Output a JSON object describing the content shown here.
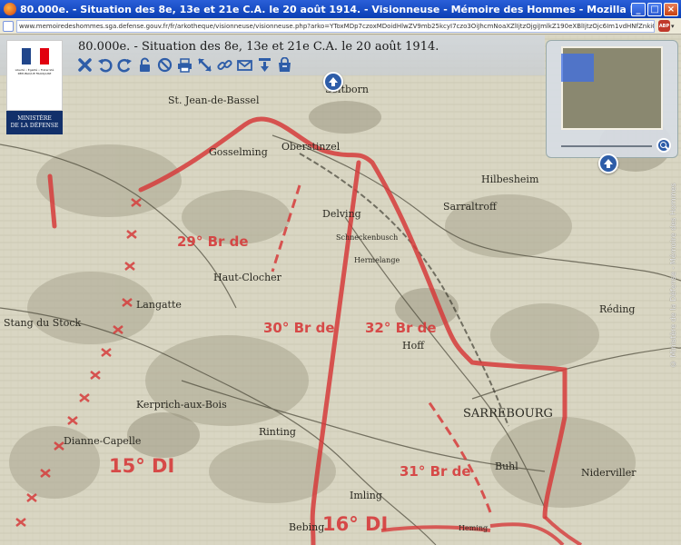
{
  "window": {
    "title": "80.000e. - Situation des 8e, 13e et 21e C.A. le 20 août 1914. - Visionneuse - Mémoire des Hommes - Mozilla Firefox",
    "min_label": "_",
    "max_label": "□",
    "close_label": "×"
  },
  "address": {
    "url": "www.memoiredeshommes.sga.defense.gouv.fr/fr/arkotheque/visionneuse/visionneuse.php?arko=YToxMDp7czoxMDoidHlwZV9mb25kcyI7czo3OiJhcmNoaXZlIjtzOjgiJmlkZ190eXBlIjtzOjc6Im1vdHNfZnkiO3M6NDoicmVmMCI7czoyOiI1NiI7czo0OiJyZWYxIjtpOjE7fQ==",
    "adblock_label": "ABP",
    "adblock_arrow": "▾"
  },
  "viewer": {
    "doc_title": "80.000e. - Situation des 8e, 13e et 21e C.A. le 20 août 1914.",
    "logo_motto": "Liberté • Égalité • Fraternité\nRÉPUBLIQUE FRANÇAISE",
    "ministry": "MINISTÈRE\nDE LA DÉFENSE",
    "copyright": "© Ministère de la Défense - Mémoire des Hommes",
    "tools": [
      "close-view",
      "rotate-left",
      "rotate-right",
      "lock",
      "no-entry",
      "print",
      "fit-screen",
      "link",
      "email",
      "download",
      "cart"
    ]
  },
  "map": {
    "place_labels": [
      "St. Jean-de-Bassel",
      "Oberstinzel",
      "Gosselming",
      "Hilbesheim",
      "Sarraltroff",
      "Delving",
      "Schneckenbusch",
      "Hermelange",
      "Haut-Clocher",
      "Langatte",
      "Hoff",
      "Réding",
      "Stang du Stock",
      "Kerprich-aux-Bois",
      "Rinting",
      "SARREBOURG",
      "Dianne-Capelle",
      "Buhl",
      "Imling",
      "Bebing",
      "Niderviller",
      "Heming"
    ],
    "unit_labels": [
      "29° Br de",
      "30° Br de",
      "32° Br de",
      "15° DI",
      "31° Br de",
      "16° DI"
    ],
    "partial_label": "Seltborn"
  },
  "colors": {
    "front_line": "#d63b3b",
    "accent": "#2e5da8"
  }
}
